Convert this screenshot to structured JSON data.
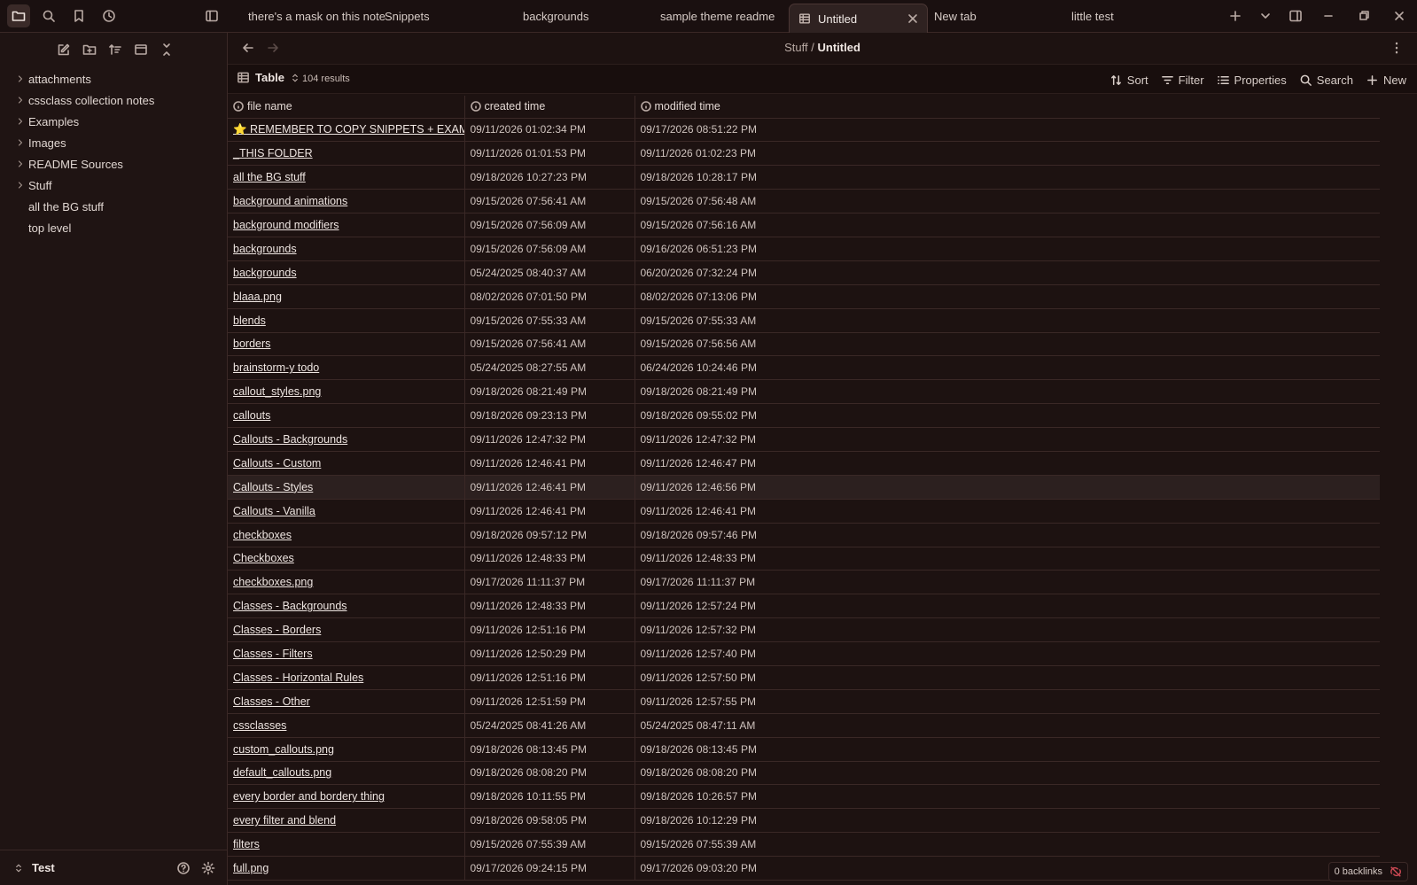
{
  "titlebar": {
    "tabs": [
      {
        "label": "there's a mask on this note"
      },
      {
        "label": "Snippets"
      },
      {
        "label": "backgrounds"
      },
      {
        "label": "sample theme readme"
      },
      {
        "label": "Untitled",
        "active": true
      },
      {
        "label": "New tab"
      },
      {
        "label": "little test"
      }
    ]
  },
  "sidebar": {
    "folders": [
      "attachments",
      "cssclass collection notes",
      "Examples",
      "Images",
      "README Sources",
      "Stuff"
    ],
    "files": [
      "all the BG stuff",
      "top level"
    ],
    "vault_name": "Test"
  },
  "navbar": {
    "breadcrumb_parent": "Stuff",
    "breadcrumb_sep": "/",
    "breadcrumb_current": "Untitled"
  },
  "toolbar": {
    "view_label": "Table",
    "result_count": "104 results",
    "sort_label": "Sort",
    "filter_label": "Filter",
    "properties_label": "Properties",
    "search_label": "Search",
    "new_label": "New"
  },
  "table": {
    "columns": [
      "file name",
      "created time",
      "modified time"
    ],
    "rows": [
      [
        "⭐ REMEMBER TO COPY SNIPPETS + EXAMPLES + ...",
        "09/11/2026 01:02:34 PM",
        "09/17/2026 08:51:22 PM"
      ],
      [
        "_THIS FOLDER",
        "09/11/2026 01:01:53 PM",
        "09/11/2026 01:02:23 PM"
      ],
      [
        "all the BG stuff",
        "09/18/2026 10:27:23 PM",
        "09/18/2026 10:28:17 PM"
      ],
      [
        "background animations",
        "09/15/2026 07:56:41 AM",
        "09/15/2026 07:56:48 AM"
      ],
      [
        "background modifiers",
        "09/15/2026 07:56:09 AM",
        "09/15/2026 07:56:16 AM"
      ],
      [
        "backgrounds",
        "09/15/2026 07:56:09 AM",
        "09/16/2026 06:51:23 PM"
      ],
      [
        "backgrounds",
        "05/24/2025 08:40:37 AM",
        "06/20/2026 07:32:24 PM"
      ],
      [
        "blaaa.png",
        "08/02/2026 07:01:50 PM",
        "08/02/2026 07:13:06 PM"
      ],
      [
        "blends",
        "09/15/2026 07:55:33 AM",
        "09/15/2026 07:55:33 AM"
      ],
      [
        "borders",
        "09/15/2026 07:56:41 AM",
        "09/15/2026 07:56:56 AM"
      ],
      [
        "brainstorm-y todo",
        "05/24/2025 08:27:55 AM",
        "06/24/2026 10:24:46 PM"
      ],
      [
        "callout_styles.png",
        "09/18/2026 08:21:49 PM",
        "09/18/2026 08:21:49 PM"
      ],
      [
        "callouts",
        "09/18/2026 09:23:13 PM",
        "09/18/2026 09:55:02 PM"
      ],
      [
        "Callouts - Backgrounds",
        "09/11/2026 12:47:32 PM",
        "09/11/2026 12:47:32 PM"
      ],
      [
        "Callouts - Custom",
        "09/11/2026 12:46:41 PM",
        "09/11/2026 12:46:47 PM"
      ],
      [
        "Callouts - Styles",
        "09/11/2026 12:46:41 PM",
        "09/11/2026 12:46:56 PM"
      ],
      [
        "Callouts - Vanilla",
        "09/11/2026 12:46:41 PM",
        "09/11/2026 12:46:41 PM"
      ],
      [
        "checkboxes",
        "09/18/2026 09:57:12 PM",
        "09/18/2026 09:57:46 PM"
      ],
      [
        "Checkboxes",
        "09/11/2026 12:48:33 PM",
        "09/11/2026 12:48:33 PM"
      ],
      [
        "checkboxes.png",
        "09/17/2026 11:11:37 PM",
        "09/17/2026 11:11:37 PM"
      ],
      [
        "Classes - Backgrounds",
        "09/11/2026 12:48:33 PM",
        "09/11/2026 12:57:24 PM"
      ],
      [
        "Classes - Borders",
        "09/11/2026 12:51:16 PM",
        "09/11/2026 12:57:32 PM"
      ],
      [
        "Classes - Filters",
        "09/11/2026 12:50:29 PM",
        "09/11/2026 12:57:40 PM"
      ],
      [
        "Classes - Horizontal Rules",
        "09/11/2026 12:51:16 PM",
        "09/11/2026 12:57:50 PM"
      ],
      [
        "Classes - Other",
        "09/11/2026 12:51:59 PM",
        "09/11/2026 12:57:55 PM"
      ],
      [
        "cssclasses",
        "05/24/2025 08:41:26 AM",
        "05/24/2025 08:47:11 AM"
      ],
      [
        "custom_callouts.png",
        "09/18/2026 08:13:45 PM",
        "09/18/2026 08:13:45 PM"
      ],
      [
        "default_callouts.png",
        "09/18/2026 08:08:20 PM",
        "09/18/2026 08:08:20 PM"
      ],
      [
        "every border and bordery thing",
        "09/18/2026 10:11:55 PM",
        "09/18/2026 10:26:57 PM"
      ],
      [
        "every filter and blend",
        "09/18/2026 09:58:05 PM",
        "09/18/2026 10:12:29 PM"
      ],
      [
        "filters",
        "09/15/2026 07:55:39 AM",
        "09/15/2026 07:55:39 AM"
      ],
      [
        "full.png",
        "09/17/2026 09:24:15 PM",
        "09/17/2026 09:03:20 PM"
      ]
    ],
    "hovered_row": 15
  },
  "status": {
    "backlinks": "0 backlinks"
  },
  "colors": {
    "background": "#1d1211",
    "sidebar": "#1f1413",
    "border": "#3a2826",
    "text": "#e6dcd6",
    "warning_icon": "#d14a55"
  }
}
